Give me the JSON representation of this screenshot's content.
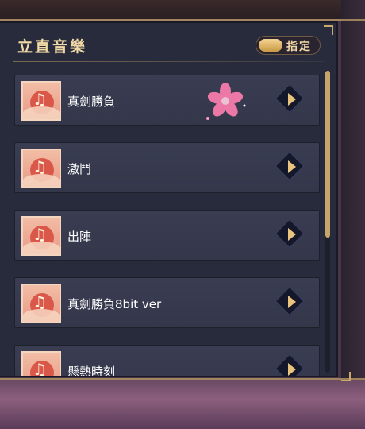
{
  "header": {
    "title": "立直音樂",
    "toggle_label": "指定"
  },
  "tracks": [
    {
      "title": "真劍勝負"
    },
    {
      "title": "激鬥"
    },
    {
      "title": "出陣"
    },
    {
      "title": "真劍勝負8bit ver"
    },
    {
      "title": "懸熱時刻"
    }
  ],
  "colors": {
    "panel": "#282b3c",
    "accent_gold": "#c9a86a",
    "row": "#3a3d52"
  },
  "icons": {
    "track_art": "music-note-sun-icon",
    "play": "play-triangle-icon",
    "decoration": "sakura-blossom-icon"
  }
}
